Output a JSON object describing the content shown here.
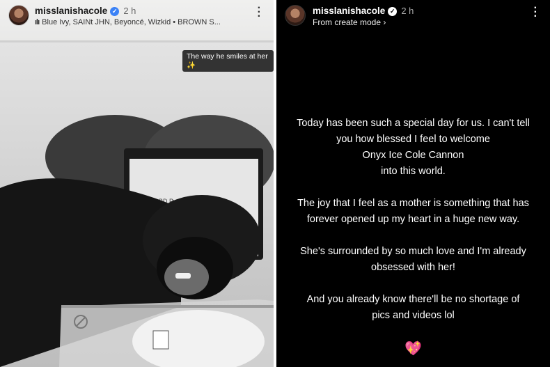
{
  "left_story": {
    "username": "misslanishacole",
    "time": "2 h",
    "music": "Blue Ivy, SAINt JHN, Beyoncé, Wizkid  •  BROWN S...",
    "caption": "The way he smiles at her ✨",
    "monitor_brand": "BD Pyxis"
  },
  "right_story": {
    "username": "misslanishacole",
    "time": "2 h",
    "mode": "From create mode",
    "paragraphs": [
      "Today has been such a special day for us. I can't tell\nyou how blessed I feel to welcome\nOnyx Ice Cole Cannon\ninto this world.",
      "The joy that I feel as a mother is something that has\nforever opened up my heart in a huge new way.",
      "She's surrounded by so much love and I'm already\nobsessed with her!",
      "And you already know there'll be no shortage of\npics and videos lol"
    ],
    "emoji": "💖"
  },
  "icons": [
    "verified-badge-icon",
    "more-options-icon",
    "music-icon",
    "chevron-right-icon",
    "sparkles-icon",
    "heart-emoji-icon"
  ]
}
